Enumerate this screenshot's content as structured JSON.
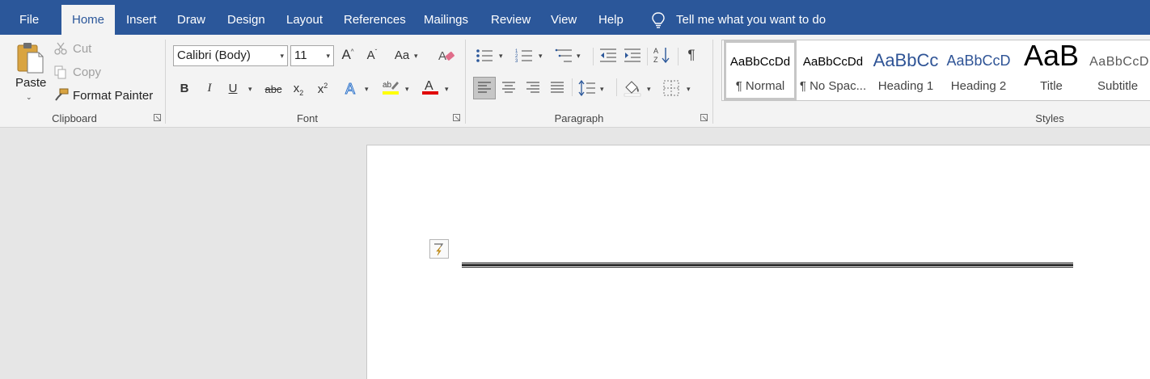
{
  "tabs": [
    {
      "label": "File",
      "active": false
    },
    {
      "label": "Home",
      "active": true
    },
    {
      "label": "Insert",
      "active": false
    },
    {
      "label": "Draw",
      "active": false
    },
    {
      "label": "Design",
      "active": false
    },
    {
      "label": "Layout",
      "active": false
    },
    {
      "label": "References",
      "active": false
    },
    {
      "label": "Mailings",
      "active": false
    },
    {
      "label": "Review",
      "active": false
    },
    {
      "label": "View",
      "active": false
    },
    {
      "label": "Help",
      "active": false
    }
  ],
  "tell_me": {
    "text": "Tell me what you want to do",
    "icon": "lightbulb-icon"
  },
  "clipboard": {
    "paste": "Paste",
    "cut": "Cut",
    "copy": "Copy",
    "format_painter": "Format Painter",
    "group_label": "Clipboard"
  },
  "font": {
    "family": "Calibri (Body)",
    "size": "11",
    "change_case": "Aa",
    "bold": "B",
    "italic": "I",
    "underline": "U",
    "strike": "abc",
    "group_label": "Font",
    "highlight_color": "#ffff00",
    "font_color": "#ff0000"
  },
  "paragraph": {
    "group_label": "Paragraph",
    "pilcrow": "¶"
  },
  "styles": {
    "group_label": "Styles",
    "items": [
      {
        "preview": "AaBbCcDd",
        "name": "¶ Normal"
      },
      {
        "preview": "AaBbCcDd",
        "name": "¶ No Spac..."
      },
      {
        "preview": "AaBbCc",
        "name": "Heading 1"
      },
      {
        "preview": "AaBbCcD",
        "name": "Heading 2"
      },
      {
        "preview": "AaB",
        "name": "Title"
      },
      {
        "preview": "AaBbCcD",
        "name": "Subtitle"
      }
    ]
  },
  "colors": {
    "accent": "#2b579a",
    "ribbon": "#f3f3f3",
    "canvas": "#e6e6e6"
  }
}
